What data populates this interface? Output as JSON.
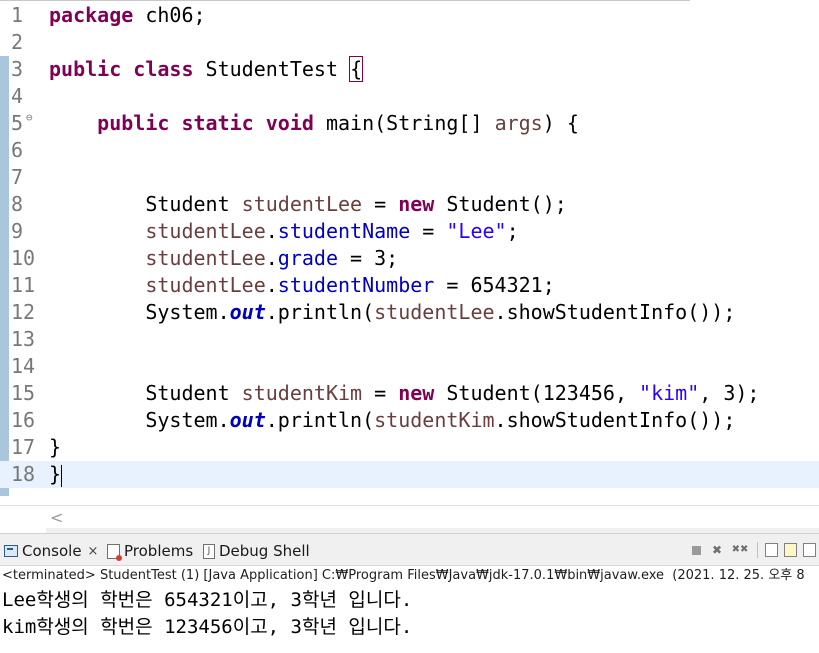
{
  "editor": {
    "lines": [
      {
        "n": "1",
        "html": "<span class=\"kw\">package</span> ch06;"
      },
      {
        "n": "2",
        "html": ""
      },
      {
        "n": "3",
        "html": "<span class=\"kw\">public</span> <span class=\"kw\">class</span> StudentTest <span class=\"brace-box\">{</span>"
      },
      {
        "n": "4",
        "html": ""
      },
      {
        "n": "5",
        "fold": true,
        "html": "    <span class=\"kw\">public</span> <span class=\"kw\">static</span> <span class=\"kw\">void</span> main(String[] <span class=\"var\">args</span>) {"
      },
      {
        "n": "6",
        "html": ""
      },
      {
        "n": "7",
        "html": ""
      },
      {
        "n": "8",
        "html": "        Student <span class=\"var\">studentLee</span> = <span class=\"kw\">new</span> Student();"
      },
      {
        "n": "9",
        "html": "        <span class=\"var\">studentLee</span>.<span class=\"fld\">studentName</span> = <span class=\"str\">\"Lee\"</span>;"
      },
      {
        "n": "10",
        "html": "        <span class=\"var\">studentLee</span>.<span class=\"fld\">grade</span> = 3;"
      },
      {
        "n": "11",
        "html": "        <span class=\"var\">studentLee</span>.<span class=\"fld\">studentNumber</span> = 654321;"
      },
      {
        "n": "12",
        "html": "        System.<span class=\"sfld\">out</span>.println(<span class=\"var\">studentLee</span>.showStudentInfo());"
      },
      {
        "n": "13",
        "html": ""
      },
      {
        "n": "14",
        "html": ""
      },
      {
        "n": "15",
        "html": "        Student <span class=\"var\">studentKim</span> = <span class=\"kw\">new</span> Student(123456, <span class=\"str\">\"kim\"</span>, 3);"
      },
      {
        "n": "16",
        "html": "        System.<span class=\"sfld\">out</span>.println(<span class=\"var\">studentKim</span>.showStudentInfo());"
      },
      {
        "n": "17",
        "html": "}"
      },
      {
        "n": "18",
        "current": true,
        "html": "}<span class=\"cursor\"></span>"
      }
    ]
  },
  "console": {
    "tabs": {
      "console_label": "Console",
      "console_close": "×",
      "problems_label": "Problems",
      "debug_label": "Debug Shell"
    },
    "status": "<terminated> StudentTest (1) [Java Application] C:₩Program Files₩Java₩jdk-17.0.1₩bin₩javaw.exe  (2021. 12. 25. 오후 8",
    "output": [
      "Lee학생의 학번은 654321이고, 3학년 입니다.",
      "kim학생의 학번은 123456이고, 3학년 입니다."
    ]
  },
  "icons": {
    "scroll_left": "<",
    "terminate": "■",
    "remove": "✖",
    "remove_all": "✖✖",
    "debug_glyph": "J"
  }
}
